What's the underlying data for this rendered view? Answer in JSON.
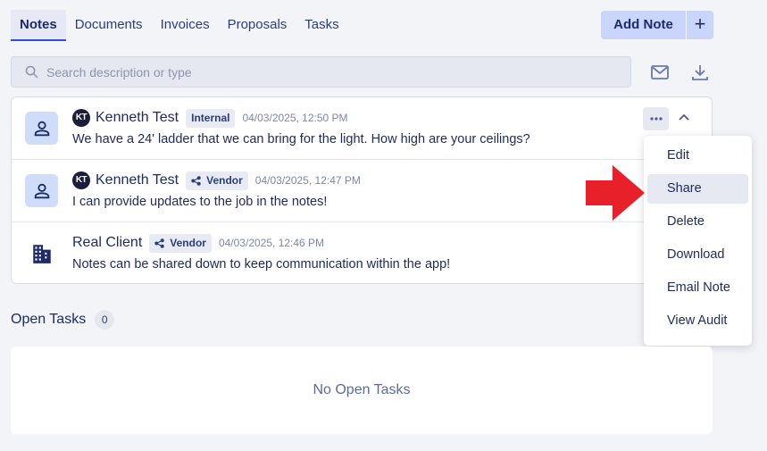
{
  "tabs": [
    {
      "label": "Notes",
      "active": true
    },
    {
      "label": "Documents"
    },
    {
      "label": "Invoices"
    },
    {
      "label": "Proposals"
    },
    {
      "label": "Tasks"
    }
  ],
  "add_note": {
    "label": "Add Note",
    "plus": "+"
  },
  "search": {
    "placeholder": "Search description or type"
  },
  "notes": [
    {
      "avatar_icon": "person-icon",
      "initials": "KT",
      "author": "Kenneth Test",
      "badge": "Internal",
      "timestamp": "04/03/2025, 12:50 PM",
      "body": "We have a 24' ladder that we can bring for the light. How high are your ceilings?"
    },
    {
      "avatar_icon": "person-icon",
      "initials": "KT",
      "author": "Kenneth Test",
      "badge": "Vendor",
      "badge_icon": "share-icon",
      "timestamp": "04/03/2025, 12:47 PM",
      "body": "I can provide updates to the job in the notes!"
    },
    {
      "avatar_icon": "building-icon",
      "author": "Real Client",
      "badge": "Vendor",
      "badge_icon": "share-icon",
      "timestamp": "04/03/2025, 12:46 PM",
      "body": "Notes can be shared down to keep communication within the app!"
    }
  ],
  "menu": {
    "items": [
      "Edit",
      "Share",
      "Delete",
      "Download",
      "Email Note",
      "View Audit"
    ],
    "highlighted": "Share"
  },
  "open_tasks": {
    "title": "Open Tasks",
    "count": "0",
    "empty_text": "No Open Tasks"
  },
  "colors": {
    "accent": "#2b4fd8",
    "arrow": "#e8202a",
    "button_bg": "#c9d5fb"
  }
}
